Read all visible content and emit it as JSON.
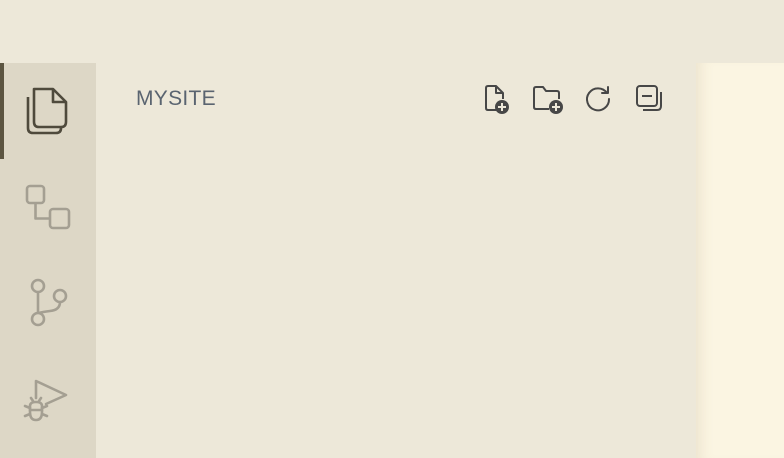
{
  "explorer": {
    "title": "MYSITE"
  },
  "activity_bar": {
    "items": [
      {
        "icon": "files-icon",
        "active": true
      },
      {
        "icon": "structure-icon",
        "active": false
      },
      {
        "icon": "source-control-icon",
        "active": false
      },
      {
        "icon": "run-debug-icon",
        "active": false
      }
    ]
  },
  "toolbar": {
    "icons": [
      "new-file-icon",
      "new-folder-icon",
      "refresh-icon",
      "collapse-all-icon"
    ]
  },
  "colors": {
    "background": "#ede8d9",
    "activity_bar": "#ddd7c6",
    "active_indicator": "#5c5541",
    "active_icon": "#4f4a3c",
    "inactive_icon": "#a49f92",
    "toolbar_icon": "#474747",
    "title_text": "#5a6470",
    "editor": "#fbf5e2"
  }
}
